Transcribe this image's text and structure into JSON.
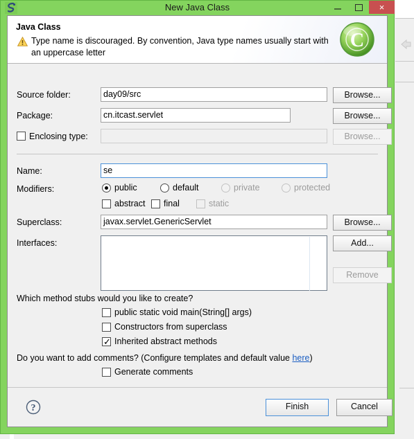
{
  "window": {
    "title": "New Java Class",
    "icon": "eclipse-icon",
    "minimize_label": "Minimize",
    "maximize_label": "Maximize",
    "close_label": "×"
  },
  "header": {
    "title": "Java Class",
    "message": "Type name is discouraged. By convention, Java type names usually start with an uppercase letter",
    "warning_icon": "warning-triangle-icon",
    "logo_icon": "java-class-logo-icon",
    "logo_letter": "C"
  },
  "form": {
    "source_folder": {
      "label": "Source folder:",
      "value": "day09/src",
      "browse": "Browse..."
    },
    "package": {
      "label": "Package:",
      "value": "cn.itcast.servlet",
      "browse": "Browse..."
    },
    "enclosing_type": {
      "label": "Enclosing type:",
      "value": "",
      "browse": "Browse...",
      "checked": false,
      "enabled": false
    },
    "name": {
      "label": "Name:",
      "value": "se"
    },
    "modifiers": {
      "label": "Modifiers:",
      "radios": [
        {
          "label": "public",
          "selected": true,
          "enabled": true
        },
        {
          "label": "default",
          "selected": false,
          "enabled": true
        },
        {
          "label": "private",
          "selected": false,
          "enabled": false
        },
        {
          "label": "protected",
          "selected": false,
          "enabled": false
        }
      ],
      "checkboxes": [
        {
          "label": "abstract",
          "checked": false,
          "enabled": true
        },
        {
          "label": "final",
          "checked": false,
          "enabled": true
        },
        {
          "label": "static",
          "checked": false,
          "enabled": false
        }
      ]
    },
    "superclass": {
      "label": "Superclass:",
      "value": "javax.servlet.GenericServlet",
      "browse": "Browse..."
    },
    "interfaces": {
      "label": "Interfaces:",
      "items": [],
      "add": "Add...",
      "remove": "Remove"
    },
    "stubs": {
      "question": "Which method stubs would you like to create?",
      "options": [
        {
          "label": "public static void main(String[] args)",
          "checked": false
        },
        {
          "label": "Constructors from superclass",
          "checked": false
        },
        {
          "label": "Inherited abstract methods",
          "checked": true
        }
      ]
    },
    "comments": {
      "question_before": "Do you want to add comments? (Configure templates and default value ",
      "link": "here",
      "question_after": ")",
      "option": {
        "label": "Generate comments",
        "checked": false
      }
    }
  },
  "footer": {
    "help_icon": "help-question-icon",
    "finish": "Finish",
    "cancel": "Cancel"
  }
}
